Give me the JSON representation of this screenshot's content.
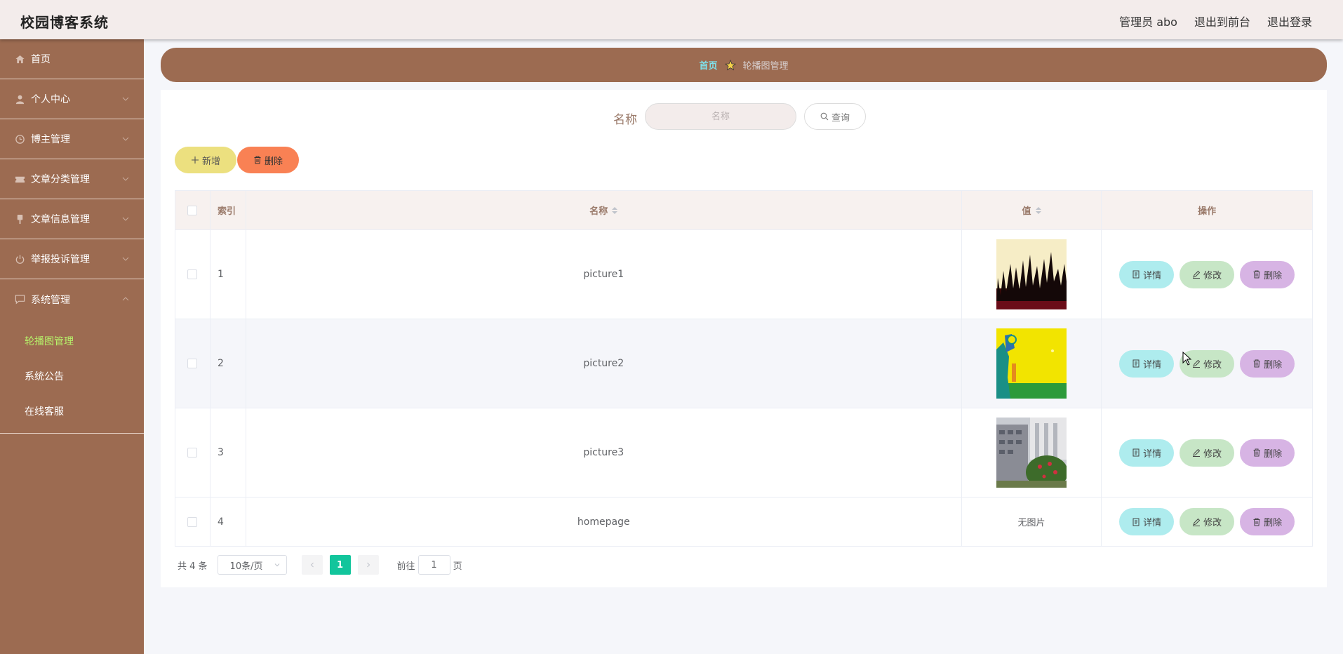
{
  "app": {
    "title": "校园博客系统",
    "user": "管理员 abo",
    "to_front": "退出到前台",
    "logout": "退出登录"
  },
  "sidebar": {
    "items": [
      {
        "label": "首页",
        "icon": "home-icon"
      },
      {
        "label": "个人中心",
        "icon": "user-icon"
      },
      {
        "label": "博主管理",
        "icon": "clock-icon"
      },
      {
        "label": "文章分类管理",
        "icon": "ticket-icon"
      },
      {
        "label": "文章信息管理",
        "icon": "brush-icon"
      },
      {
        "label": "举报投诉管理",
        "icon": "power-icon"
      },
      {
        "label": "系统管理",
        "icon": "chat-icon"
      }
    ],
    "sub_items": [
      {
        "label": "轮播图管理",
        "active": true
      },
      {
        "label": "系统公告",
        "active": false
      },
      {
        "label": "在线客服",
        "active": false
      }
    ],
    "active_color": "#b6f26a"
  },
  "breadcrumb": {
    "home": "首页",
    "current": "轮播图管理"
  },
  "search": {
    "label": "名称",
    "placeholder": "名称",
    "query_button": "查询"
  },
  "toolbar": {
    "add_label": "新增",
    "delete_label": "删除"
  },
  "table": {
    "headers": {
      "index": "索引",
      "name": "名称",
      "value": "值",
      "ops": "操作"
    },
    "rows": [
      {
        "index": "1",
        "name": "picture1",
        "value_type": "image",
        "image": "dark-grass-silhouette"
      },
      {
        "index": "2",
        "name": "picture2",
        "value_type": "image",
        "image": "yellow-field"
      },
      {
        "index": "3",
        "name": "picture3",
        "value_type": "image",
        "image": "campus-building"
      },
      {
        "index": "4",
        "name": "homepage",
        "value_type": "text",
        "value_text": "无图片"
      }
    ],
    "op_labels": {
      "detail": "详情",
      "edit": "修改",
      "delete": "删除"
    }
  },
  "pagination": {
    "total": "共 4 条",
    "page_size": "10条/页",
    "current_page": "1",
    "goto_prefix": "前往",
    "goto_value": "1",
    "goto_suffix": "页"
  },
  "colors": {
    "sidebar": "#9c6b51",
    "header": "#f3eceb",
    "accent": "#12c59c",
    "add": "#ece07f",
    "delete": "#f98154"
  }
}
